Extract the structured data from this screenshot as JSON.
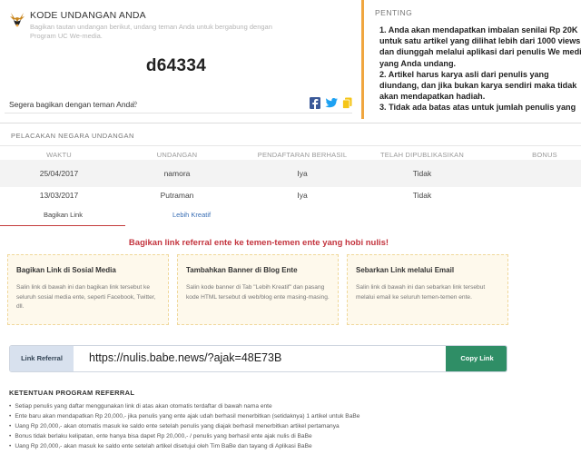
{
  "invite": {
    "title": "KODE UNDANGAN ANDA",
    "description": "Bagikan tautan undangan berikut, undang teman Anda untuk bergabung dengan Program UC We-media.",
    "code": "d64334",
    "share_text": "Segera bagikan dengan teman Anda.",
    "chevron": "»",
    "share_icons": [
      "facebook-icon",
      "twitter-icon",
      "copy-icon"
    ],
    "colors": {
      "facebook": "#3b5998",
      "twitter": "#1da1f2",
      "copy": "#f5c518"
    }
  },
  "penting": {
    "title": "PENTING",
    "body": "1. Anda akan mendapatkan imbalan senilai Rp 20K untuk satu artikel yang dilihat lebih dari 1000 views, dan diunggah melalui aplikasi dari penulis We media yang Anda undang.\n2. Artikel harus karya asli dari penulis yang diundang, dan jika bukan karya sendiri maka tidak akan mendapatkan hadiah.\n3. Tidak ada batas atas untuk jumlah penulis yang",
    "accent": "#f0a63f"
  },
  "tracking": {
    "title": "PELACAKAN NEGARA UNDANGAN",
    "headers": [
      "WAKTU",
      "UNDANGAN",
      "PENDAFTARAN BERHASIL",
      "TELAH DIPUBLIKASIKAN",
      "BONUS"
    ],
    "rows": [
      [
        "25/04/2017",
        "namora",
        "Iya",
        "Tidak",
        ""
      ],
      [
        "13/03/2017",
        "Putraman",
        "Iya",
        "Tidak",
        ""
      ]
    ]
  },
  "tabs": [
    {
      "label": "Bagikan Link",
      "active": true
    },
    {
      "label": "Lebih Kreatif",
      "active": false
    }
  ],
  "main": {
    "headline": "Bagikan link referral ente ke temen-temen ente yang hobi nulis!",
    "boxes": [
      {
        "title": "Bagikan Link di Sosial Media",
        "text": "Salin link di bawah ini dan bagikan link tersebut ke seluruh sosial media ente, seperti Facebook, Twitter, dll."
      },
      {
        "title": "Tambahkan Banner di Blog Ente",
        "text": "Salin kode banner di Tab \"Lebih Kreatif\" dan pasang kode HTML tersebut di web/blog ente masing-masing."
      },
      {
        "title": "Sebarkan Link melalui Email",
        "text": "Salin link di bawah ini dan sebarkan link tersebut melalui email ke seluruh temen-temen ente."
      }
    ],
    "referral": {
      "label": "Link Referral",
      "value": "https://nulis.babe.news/?ajak=48E73B",
      "button": "Copy Link"
    },
    "terms_title": "KETENTUAN PROGRAM REFERRAL",
    "terms": [
      "Setiap penulis yang daftar menggunakan link di atas akan otomatis terdaftar di bawah nama ente",
      "Ente baru akan mendapatkan Rp 20,000,- jika penulis yang ente ajak udah berhasil menerbitkan (setidaknya) 1 artikel untuk BaBe",
      "Uang Rp 20,000,- akan otomatis masuk ke saldo ente setelah penulis yang diajak berhasil menerbitkan artikel pertamanya",
      "Bonus tidak berlaku kelipatan, ente hanya bisa dapet Rp 20,000,- / penulis yang berhasil ente ajak nulis di BaBe",
      "Uang Rp 20,000,- akan masuk ke saldo ente setelah artikel disetujui oleh Tim BaBe dan tayang di Aplikasi BaBe"
    ]
  }
}
